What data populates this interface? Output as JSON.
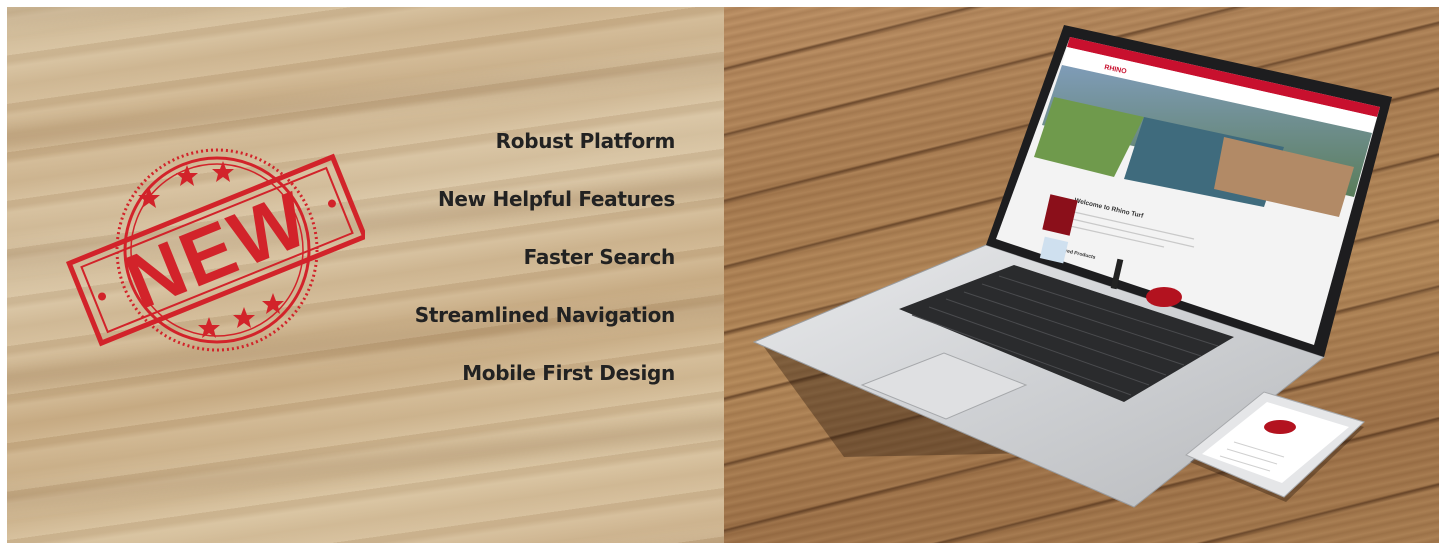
{
  "stamp": {
    "word": "NEW"
  },
  "features": [
    "Robust Platform",
    "New Helpful Features",
    "Faster Search",
    "Streamlined Navigation",
    "Mobile First Design"
  ],
  "laptop_screen": {
    "welcome_heading": "Welcome to Rhino Turf",
    "featured_label": "Featured Products"
  },
  "colors": {
    "stamp_red": "#d2232a",
    "text_dark": "#222222",
    "brand_red": "#c8102e"
  }
}
